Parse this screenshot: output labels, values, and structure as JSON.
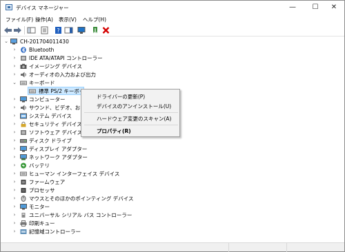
{
  "window": {
    "title": "デバイス マネージャー",
    "controls": {
      "minimize": "—",
      "maximize": "☐",
      "close": "✕"
    }
  },
  "menubar": {
    "items": [
      "ファイル(F)",
      "操作(A)",
      "表示(V)",
      "ヘルプ(H)"
    ]
  },
  "toolbar": {
    "buttons": [
      "back-icon",
      "forward-icon",
      "show-hide-tree-icon",
      "properties-icon",
      "help-icon",
      "action-pane-icon",
      "scan-hardware-icon",
      "update-driver-icon",
      "uninstall-icon"
    ]
  },
  "tree": {
    "root": "CH-201704011430",
    "categories": [
      "Bluetooth",
      "IDE ATA/ATAPI コントローラー",
      "イメージング デバイス",
      "オーディオの入力および出力",
      "キーボード",
      "標準 PS/2 キーボード",
      "コンピューター",
      "サウンド、ビデオ、およびゲ",
      "システム デバイス",
      "セキュリティ デバイス",
      "ソフトウェア デバイス",
      "ディスク ドライブ",
      "ディスプレイ アダプター",
      "ネットワーク アダプター",
      "バッテリ",
      "ヒューマン インターフェイス デバイス",
      "ファームウェア",
      "プロセッサ",
      "マウスとそのほかのポインティング デバイス",
      "モニター",
      "ユニバーサル シリアル バス コントローラー",
      "印刷キュー",
      "記憶域コントローラー"
    ]
  },
  "context_menu": {
    "items": [
      "ドライバーの更新(P)",
      "デバイスのアンインストール(U)",
      "ハードウェア変更のスキャン(A)",
      "プロパティ(R)"
    ]
  },
  "colors": {
    "selection": "#cce8ff",
    "selection_border": "#99d1ff",
    "uninstall_red": "#d40000",
    "menu_bg": "#f2f2f2"
  }
}
